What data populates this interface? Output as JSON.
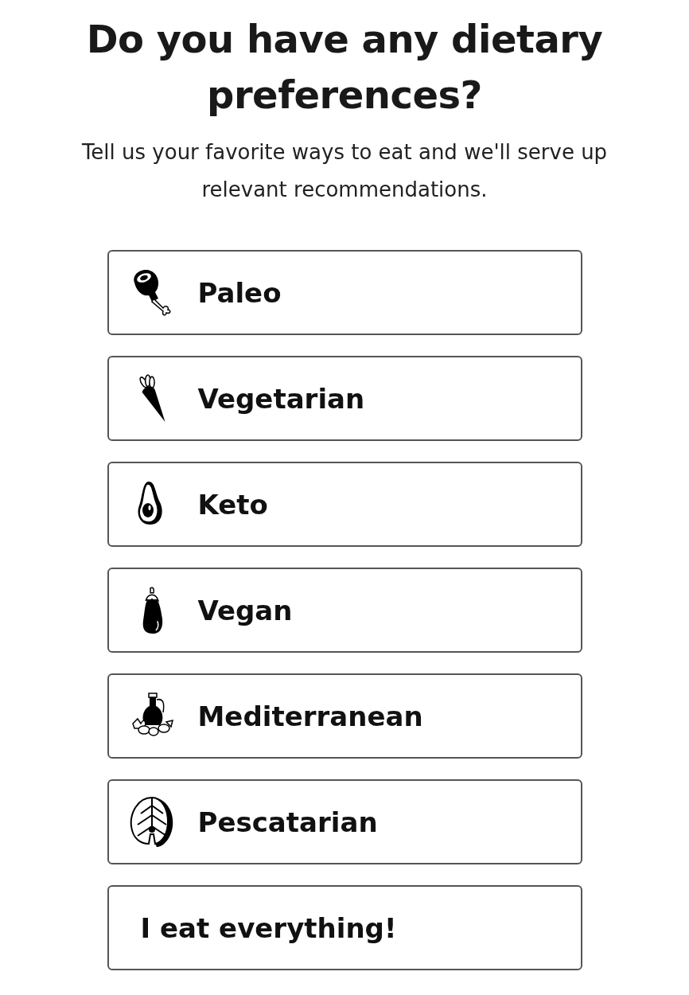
{
  "title": "Do you have any dietary preferences?",
  "subtitle": "Tell us your favorite ways to eat and we'll serve up relevant recommendations.",
  "options": [
    {
      "label": "Paleo",
      "kind": "meat"
    },
    {
      "label": "Vegetarian",
      "kind": "carrot"
    },
    {
      "label": "Keto",
      "kind": "avocado"
    },
    {
      "label": "Vegan",
      "kind": "eggplant"
    },
    {
      "label": "Mediterranean",
      "kind": "oil"
    },
    {
      "label": "Pescatarian",
      "kind": "salmon"
    },
    {
      "label": "I eat everything!",
      "kind": "text"
    }
  ]
}
